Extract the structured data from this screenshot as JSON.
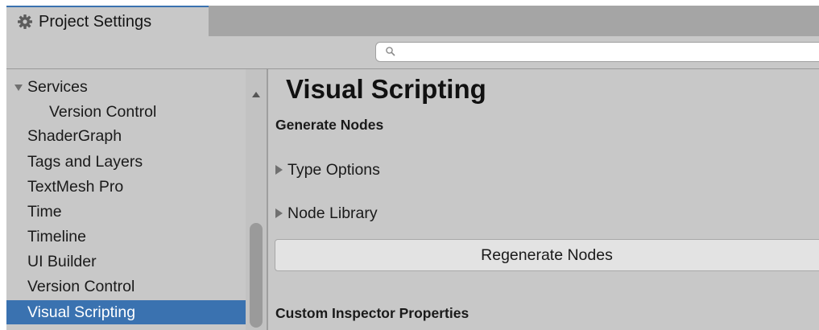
{
  "window": {
    "tab_title": "Project Settings",
    "tab_icon": "gear-icon"
  },
  "search": {
    "value": "",
    "placeholder": "",
    "icon": "search-icon"
  },
  "sidebar": {
    "items": [
      {
        "label": "Services",
        "expanded": true
      },
      {
        "label": "Version Control"
      },
      {
        "label": "ShaderGraph"
      },
      {
        "label": "Tags and Layers"
      },
      {
        "label": "TextMesh Pro"
      },
      {
        "label": "Time"
      },
      {
        "label": "Timeline"
      },
      {
        "label": "UI Builder"
      },
      {
        "label": "Version Control"
      },
      {
        "label": "Visual Scripting",
        "selected": true
      }
    ]
  },
  "main": {
    "title": "Visual Scripting",
    "generate_nodes_header": "Generate Nodes",
    "type_options_label": "Type Options",
    "node_library_label": "Node Library",
    "regenerate_button_label": "Regenerate Nodes",
    "custom_inspector_header": "Custom Inspector Properties"
  },
  "colors": {
    "panel_background": "#c8c8c8",
    "selection": "#3a72b0",
    "tab_strip": "#a5a5a5",
    "button": "#e3e3e3"
  }
}
